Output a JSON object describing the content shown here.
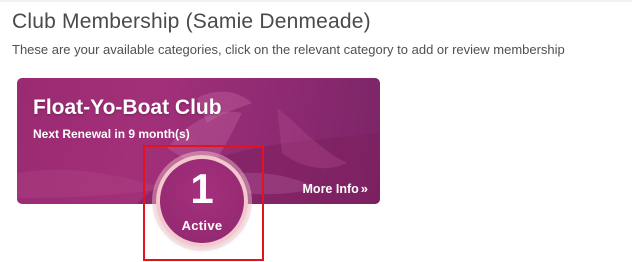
{
  "header": {
    "title": "Club Membership (Samie Denmeade)",
    "subtitle": "These are your available categories, click on the relevant category to add or review membership"
  },
  "card": {
    "title": "Float-Yo-Boat Club",
    "renewal": "Next Renewal in 9 month(s)",
    "more_info_label": "More Info",
    "more_info_icon": "double-chevron-right-icon",
    "badge_count": "1",
    "badge_status": "Active"
  },
  "colors": {
    "card_accent": "#a23079",
    "badge_ring": "#f3c7cd",
    "highlight": "#e3121c"
  }
}
